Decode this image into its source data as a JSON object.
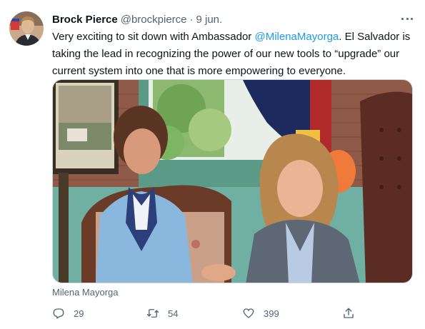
{
  "tweet": {
    "author_name": "Brock Pierce",
    "handle": "@brockpierce",
    "separator": "·",
    "date": "9 jun.",
    "text_part1": "Very exciting to sit down with Ambassador ",
    "mention": "@MilenaMayorga",
    "text_part2": ".  El Salvador is taking the lead in recognizing the power of our new tools to “upgrade” our current system into one that is more empowering to everyone.",
    "photo_caption": "Milena Mayorga"
  },
  "actions": {
    "replies": "29",
    "retweets": "54",
    "likes": "399"
  },
  "icons": {
    "more": "more-horizontal-icon",
    "reply": "reply-icon",
    "retweet": "retweet-icon",
    "like": "heart-icon",
    "share": "share-icon"
  },
  "colors": {
    "link": "#1d9bf0",
    "secondary_text": "#536471"
  }
}
